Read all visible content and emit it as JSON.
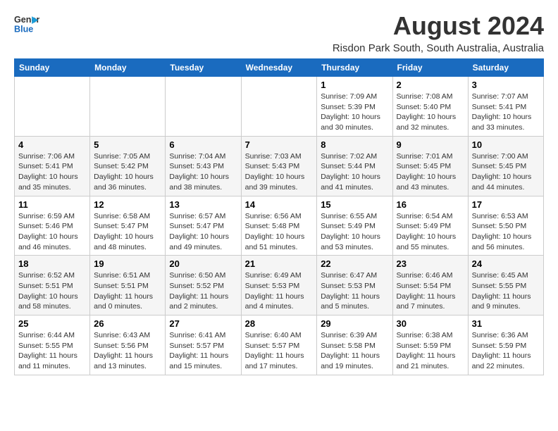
{
  "logo": {
    "line1": "General",
    "line2": "Blue"
  },
  "title": "August 2024",
  "subtitle": "Risdon Park South, South Australia, Australia",
  "days_of_week": [
    "Sunday",
    "Monday",
    "Tuesday",
    "Wednesday",
    "Thursday",
    "Friday",
    "Saturday"
  ],
  "weeks": [
    [
      {
        "day": "",
        "info": ""
      },
      {
        "day": "",
        "info": ""
      },
      {
        "day": "",
        "info": ""
      },
      {
        "day": "",
        "info": ""
      },
      {
        "day": "1",
        "info": "Sunrise: 7:09 AM\nSunset: 5:39 PM\nDaylight: 10 hours\nand 30 minutes."
      },
      {
        "day": "2",
        "info": "Sunrise: 7:08 AM\nSunset: 5:40 PM\nDaylight: 10 hours\nand 32 minutes."
      },
      {
        "day": "3",
        "info": "Sunrise: 7:07 AM\nSunset: 5:41 PM\nDaylight: 10 hours\nand 33 minutes."
      }
    ],
    [
      {
        "day": "4",
        "info": "Sunrise: 7:06 AM\nSunset: 5:41 PM\nDaylight: 10 hours\nand 35 minutes."
      },
      {
        "day": "5",
        "info": "Sunrise: 7:05 AM\nSunset: 5:42 PM\nDaylight: 10 hours\nand 36 minutes."
      },
      {
        "day": "6",
        "info": "Sunrise: 7:04 AM\nSunset: 5:43 PM\nDaylight: 10 hours\nand 38 minutes."
      },
      {
        "day": "7",
        "info": "Sunrise: 7:03 AM\nSunset: 5:43 PM\nDaylight: 10 hours\nand 39 minutes."
      },
      {
        "day": "8",
        "info": "Sunrise: 7:02 AM\nSunset: 5:44 PM\nDaylight: 10 hours\nand 41 minutes."
      },
      {
        "day": "9",
        "info": "Sunrise: 7:01 AM\nSunset: 5:45 PM\nDaylight: 10 hours\nand 43 minutes."
      },
      {
        "day": "10",
        "info": "Sunrise: 7:00 AM\nSunset: 5:45 PM\nDaylight: 10 hours\nand 44 minutes."
      }
    ],
    [
      {
        "day": "11",
        "info": "Sunrise: 6:59 AM\nSunset: 5:46 PM\nDaylight: 10 hours\nand 46 minutes."
      },
      {
        "day": "12",
        "info": "Sunrise: 6:58 AM\nSunset: 5:47 PM\nDaylight: 10 hours\nand 48 minutes."
      },
      {
        "day": "13",
        "info": "Sunrise: 6:57 AM\nSunset: 5:47 PM\nDaylight: 10 hours\nand 49 minutes."
      },
      {
        "day": "14",
        "info": "Sunrise: 6:56 AM\nSunset: 5:48 PM\nDaylight: 10 hours\nand 51 minutes."
      },
      {
        "day": "15",
        "info": "Sunrise: 6:55 AM\nSunset: 5:49 PM\nDaylight: 10 hours\nand 53 minutes."
      },
      {
        "day": "16",
        "info": "Sunrise: 6:54 AM\nSunset: 5:49 PM\nDaylight: 10 hours\nand 55 minutes."
      },
      {
        "day": "17",
        "info": "Sunrise: 6:53 AM\nSunset: 5:50 PM\nDaylight: 10 hours\nand 56 minutes."
      }
    ],
    [
      {
        "day": "18",
        "info": "Sunrise: 6:52 AM\nSunset: 5:51 PM\nDaylight: 10 hours\nand 58 minutes."
      },
      {
        "day": "19",
        "info": "Sunrise: 6:51 AM\nSunset: 5:51 PM\nDaylight: 11 hours\nand 0 minutes."
      },
      {
        "day": "20",
        "info": "Sunrise: 6:50 AM\nSunset: 5:52 PM\nDaylight: 11 hours\nand 2 minutes."
      },
      {
        "day": "21",
        "info": "Sunrise: 6:49 AM\nSunset: 5:53 PM\nDaylight: 11 hours\nand 4 minutes."
      },
      {
        "day": "22",
        "info": "Sunrise: 6:47 AM\nSunset: 5:53 PM\nDaylight: 11 hours\nand 5 minutes."
      },
      {
        "day": "23",
        "info": "Sunrise: 6:46 AM\nSunset: 5:54 PM\nDaylight: 11 hours\nand 7 minutes."
      },
      {
        "day": "24",
        "info": "Sunrise: 6:45 AM\nSunset: 5:55 PM\nDaylight: 11 hours\nand 9 minutes."
      }
    ],
    [
      {
        "day": "25",
        "info": "Sunrise: 6:44 AM\nSunset: 5:55 PM\nDaylight: 11 hours\nand 11 minutes."
      },
      {
        "day": "26",
        "info": "Sunrise: 6:43 AM\nSunset: 5:56 PM\nDaylight: 11 hours\nand 13 minutes."
      },
      {
        "day": "27",
        "info": "Sunrise: 6:41 AM\nSunset: 5:57 PM\nDaylight: 11 hours\nand 15 minutes."
      },
      {
        "day": "28",
        "info": "Sunrise: 6:40 AM\nSunset: 5:57 PM\nDaylight: 11 hours\nand 17 minutes."
      },
      {
        "day": "29",
        "info": "Sunrise: 6:39 AM\nSunset: 5:58 PM\nDaylight: 11 hours\nand 19 minutes."
      },
      {
        "day": "30",
        "info": "Sunrise: 6:38 AM\nSunset: 5:59 PM\nDaylight: 11 hours\nand 21 minutes."
      },
      {
        "day": "31",
        "info": "Sunrise: 6:36 AM\nSunset: 5:59 PM\nDaylight: 11 hours\nand 22 minutes."
      }
    ]
  ]
}
